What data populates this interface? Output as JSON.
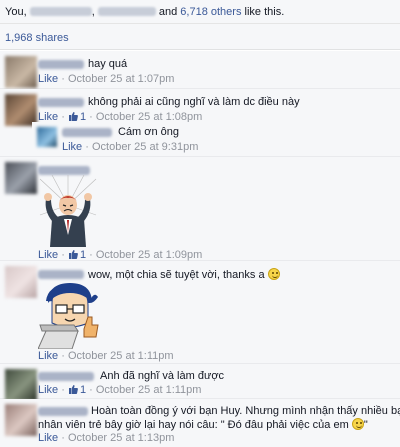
{
  "likes": {
    "prefix": "You,",
    "separator": ",",
    "and": "and",
    "others_link": "6,718 others",
    "suffix": "like this."
  },
  "shares": {
    "label": "1,968 shares"
  },
  "comments": [
    {
      "text": "hay quá",
      "like_label": "Like",
      "like_count": "",
      "time": "October 25 at 1:07pm"
    },
    {
      "text": "không phải ai cũng nghĩ và làm dc điều này",
      "like_label": "Like",
      "like_count": "1",
      "time": "October 25 at 1:08pm",
      "reply": {
        "text": "Cám ơn ông",
        "like_label": "Like",
        "time": "October 25 at 9:31pm"
      }
    },
    {
      "text": "",
      "like_label": "Like",
      "like_count": "1",
      "time": "October 25 at 1:09pm",
      "sticker": "angry-businessman-sticker"
    },
    {
      "text": "wow, một chia sẽ tuyệt vời, thanks a",
      "like_label": "Like",
      "like_count": "",
      "time": "October 25 at 1:11pm",
      "sticker": "thumbs-up-laptop-sticker"
    },
    {
      "text": "Anh đã nghĩ và làm được",
      "like_label": "Like",
      "like_count": "1",
      "time": "October 25 at 1:11pm"
    },
    {
      "text_line1": "Hoàn toàn đồng ý với bạn Huy. Nhưng mình nhận thấy nhiều bạn",
      "text_line2": "nhân viên trẻ bây giờ lại hay nói câu: \" Đó đâu phải việc của em",
      "text_end": "\"",
      "like_label": "Like",
      "like_count": "",
      "time": "October 25 at 1:13pm"
    }
  ],
  "colors": {
    "link": "#3b5998",
    "meta": "#90949c",
    "bg": "#f6f7f9"
  },
  "icons": {
    "like_count": "thumbs-up-icon",
    "emoji": "smile-emoji-icon"
  }
}
